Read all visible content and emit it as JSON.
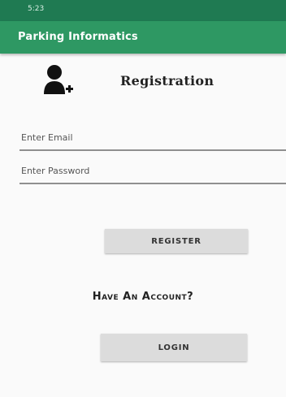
{
  "status_bar": {
    "time": "5:23"
  },
  "app_bar": {
    "title": "Parking Informatics"
  },
  "header": {
    "title": "Registration",
    "icon": "add-user-icon"
  },
  "form": {
    "email_placeholder": "Enter Email",
    "email_value": "",
    "password_placeholder": "Enter Password",
    "password_value": ""
  },
  "actions": {
    "register_label": "REGISTER",
    "have_account_text": "Have An Account?",
    "login_label": "LOGIN"
  },
  "colors": {
    "status_bar": "#1f7a52",
    "app_bar": "#2e9863",
    "button": "#dcdcdc"
  }
}
